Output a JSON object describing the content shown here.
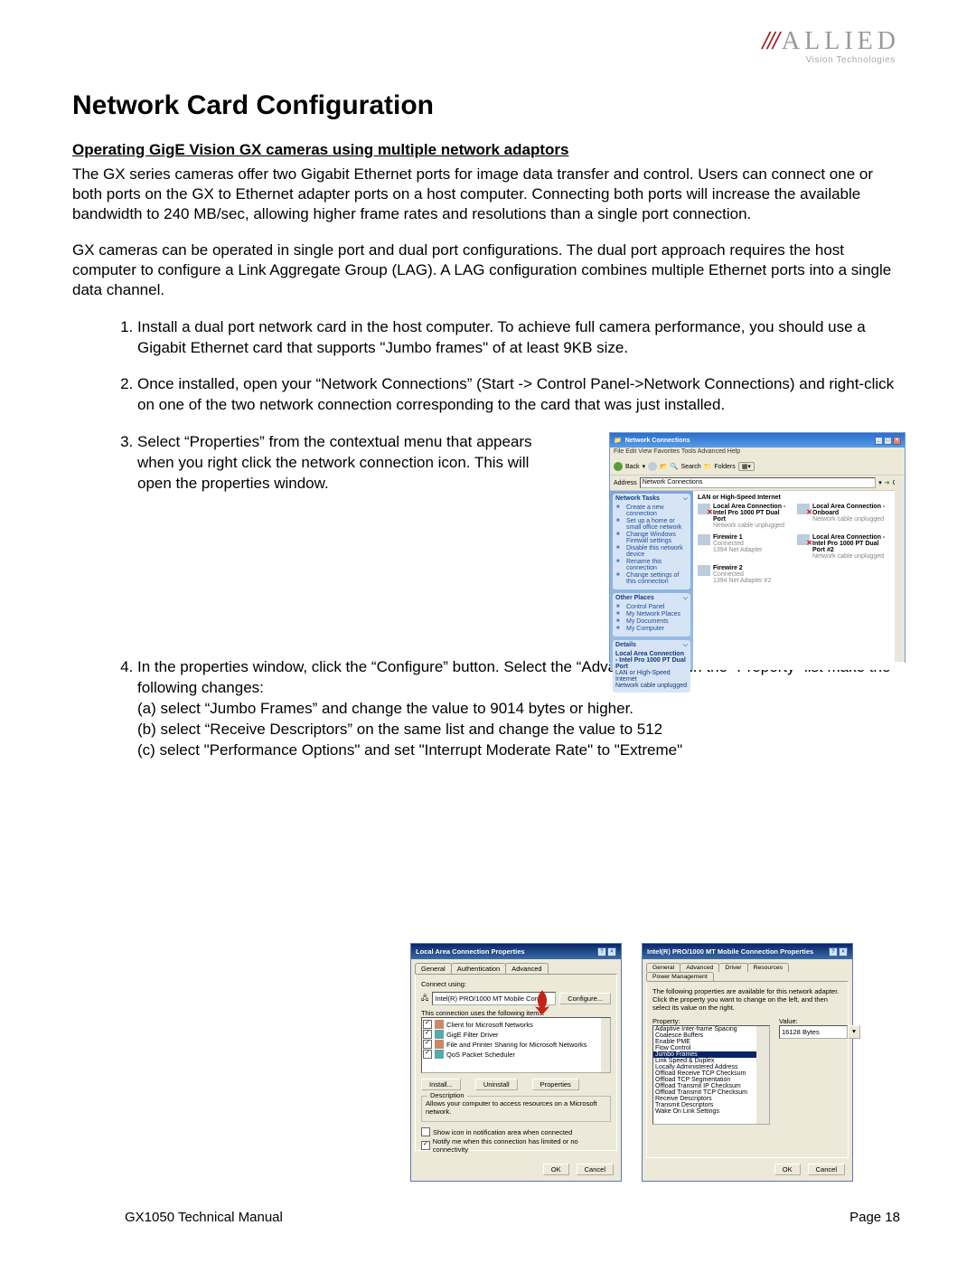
{
  "logo": {
    "slashes": "///",
    "name": "ALLIED",
    "sub": "Vision Technologies"
  },
  "title": "Network Card Configuration",
  "subtitle": "Operating GigE Vision GX cameras using multiple network adaptors",
  "para1": "The GX series cameras offer two Gigabit Ethernet ports for image data transfer and control. Users can connect one or both ports on the GX to Ethernet adapter ports on a host computer. Connecting both ports will increase the available bandwidth to 240 MB/sec, allowing higher frame rates and resolutions than a single port connection.",
  "para2": "GX cameras can be operated in single port and dual port configurations.  The dual port approach requires the host computer to configure a Link Aggregate Group (LAG).  A LAG configuration combines multiple Ethernet ports into a single data channel.",
  "steps": {
    "s1": "Install a dual port network card in the host computer.  To achieve full camera performance, you should use a Gigabit Ethernet card that supports \"Jumbo frames\" of at least 9KB size.",
    "s2": "Once installed, open your “Network Connections” (Start -> Control Panel->Network Connections) and right-click on one of the two network connection corresponding to the card that was just installed.",
    "s3": "Select “Properties” from the contextual menu that appears when you right click the network connection icon.  This will open the properties window.",
    "s4": "In the properties window, click the “Configure” button.  Select the “Advanced” tab.  In the “Property” list make the following changes:",
    "s4a": "(a) select “Jumbo Frames” and change the value to 9014 bytes or higher.",
    "s4b": "(b) select “Receive Descriptors” on the same list and change the value to 512",
    "s4c": "(c) select \"Performance Options\" and set \"Interrupt Moderate Rate\" to \"Extreme\""
  },
  "footer": {
    "left": "GX1050 Technical Manual",
    "right": "Page 18"
  },
  "nc": {
    "title": "Network Connections",
    "menu": "File  Edit  View  Favorites  Tools  Advanced  Help",
    "tool": {
      "back": "Back",
      "search": "Search",
      "folders": "Folders"
    },
    "addr": {
      "label": "Address",
      "value": "Network Connections",
      "go": "Go"
    },
    "side": {
      "tasks_h": "Network Tasks",
      "tasks": [
        "Create a new connection",
        "Set up a home or small office network",
        "Change Windows Firewall settings",
        "Disable this network device",
        "Rename this connection",
        "Change settings of this connection"
      ],
      "other_h": "Other Places",
      "other": [
        "Control Panel",
        "My Network Places",
        "My Documents",
        "My Computer"
      ],
      "details_h": "Details",
      "details": [
        "Local Area Connection - Intel Pro 1000 PT Dual Port",
        "LAN or High-Speed Internet",
        "Network cable unplugged"
      ]
    },
    "main": {
      "cat": "LAN or High-Speed Internet",
      "items": [
        {
          "name": "Local Area Connection - Intel Pro 1000 PT Dual Port",
          "l2": "Network cable unplugged",
          "unplug": true
        },
        {
          "name": "Local Area Connection - Onboard",
          "l2": "Network cable unplugged",
          "unplug": true
        },
        {
          "name": "Firewire 1",
          "l2": "Connected",
          "l3": "1394 Net Adapter",
          "unplug": false
        },
        {
          "name": "Local Area Connection - Intel Pro 1000 PT Dual Port #2",
          "l2": "Network cable unplugged",
          "unplug": true
        },
        {
          "name": "Firewire 2",
          "l2": "Connected",
          "l3": "1394 Net Adapter #2",
          "unplug": false
        }
      ]
    }
  },
  "dlg1": {
    "title": "Local Area Connection Properties",
    "tabs": [
      "General",
      "Authentication",
      "Advanced"
    ],
    "connect_using": "Connect using:",
    "adapter": "Intel(R) PRO/1000 MT Mobile Conne",
    "configure": "Configure...",
    "items_label": "This connection uses the following items:",
    "items": [
      {
        "chk": true,
        "label": "Client for Microsoft Networks"
      },
      {
        "chk": true,
        "label": "GigE Filter Driver"
      },
      {
        "chk": true,
        "label": "File and Printer Sharing for Microsoft Networks"
      },
      {
        "chk": true,
        "label": "QoS Packet Scheduler"
      }
    ],
    "btns": [
      "Install...",
      "Uninstall",
      "Properties"
    ],
    "desc_h": "Description",
    "desc": "Allows your computer to access resources on a Microsoft network.",
    "opt1": "Show icon in notification area when connected",
    "opt2": "Notify me when this connection has limited or no connectivity",
    "ok": "OK",
    "cancel": "Cancel"
  },
  "dlg2": {
    "title": "Intel(R) PRO/1000 MT Mobile Connection Properties",
    "tabs": [
      "General",
      "Advanced",
      "Driver",
      "Resources",
      "Power Management"
    ],
    "intro": "The following properties are available for this network adapter. Click the property you want to change on the left, and then select its value on the right.",
    "prop_label": "Property:",
    "val_label": "Value:",
    "props": [
      "Adaptive Inter-frame Spacing",
      "Coalesce Buffers",
      "Enable PME",
      "Flow Control",
      "Jumbo Frames",
      "Link Speed & Duplex",
      "Locally Administered Address",
      "Offload Receive TCP Checksum",
      "Offload TCP Segmentation",
      "Offload Transmit IP Checksum",
      "Offload Transmit TCP Checksum",
      "Receive Descriptors",
      "Transmit Descriptors",
      "Wake On Link Settings"
    ],
    "selected": "Jumbo Frames",
    "value": "16128 Bytes",
    "ok": "OK",
    "cancel": "Cancel"
  }
}
